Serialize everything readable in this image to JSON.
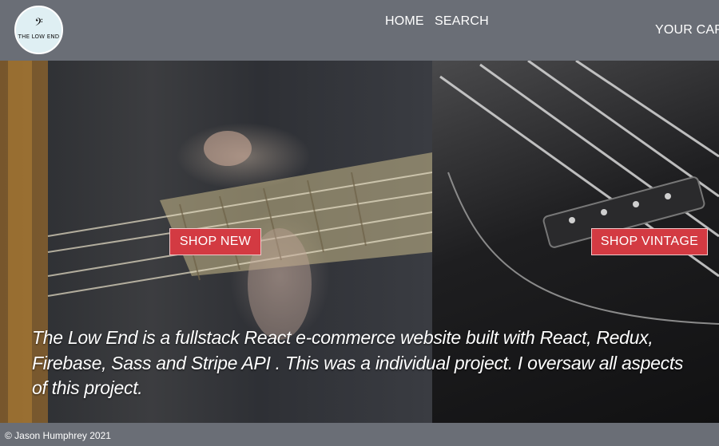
{
  "header": {
    "logo_text": "THE LOW END",
    "nav": {
      "home": "HOME",
      "search": "SEARCH",
      "cart": "YOUR CART"
    }
  },
  "hero": {
    "shop_new": "SHOP NEW",
    "shop_vintage": "SHOP VINTAGE",
    "description": "The Low End is  a fullstack React e-commerce website built with React, Redux, Firebase, Sass and Stripe API . This was a individual project. I oversaw all aspects of this project."
  },
  "footer": {
    "copyright": "© Jason Humphrey 2021"
  },
  "colors": {
    "header_bg": "#6a6e76",
    "button_bg": "#d33a42",
    "logo_bg": "#dfeff3"
  },
  "icons": {
    "logo": "bass-clef-icon"
  }
}
